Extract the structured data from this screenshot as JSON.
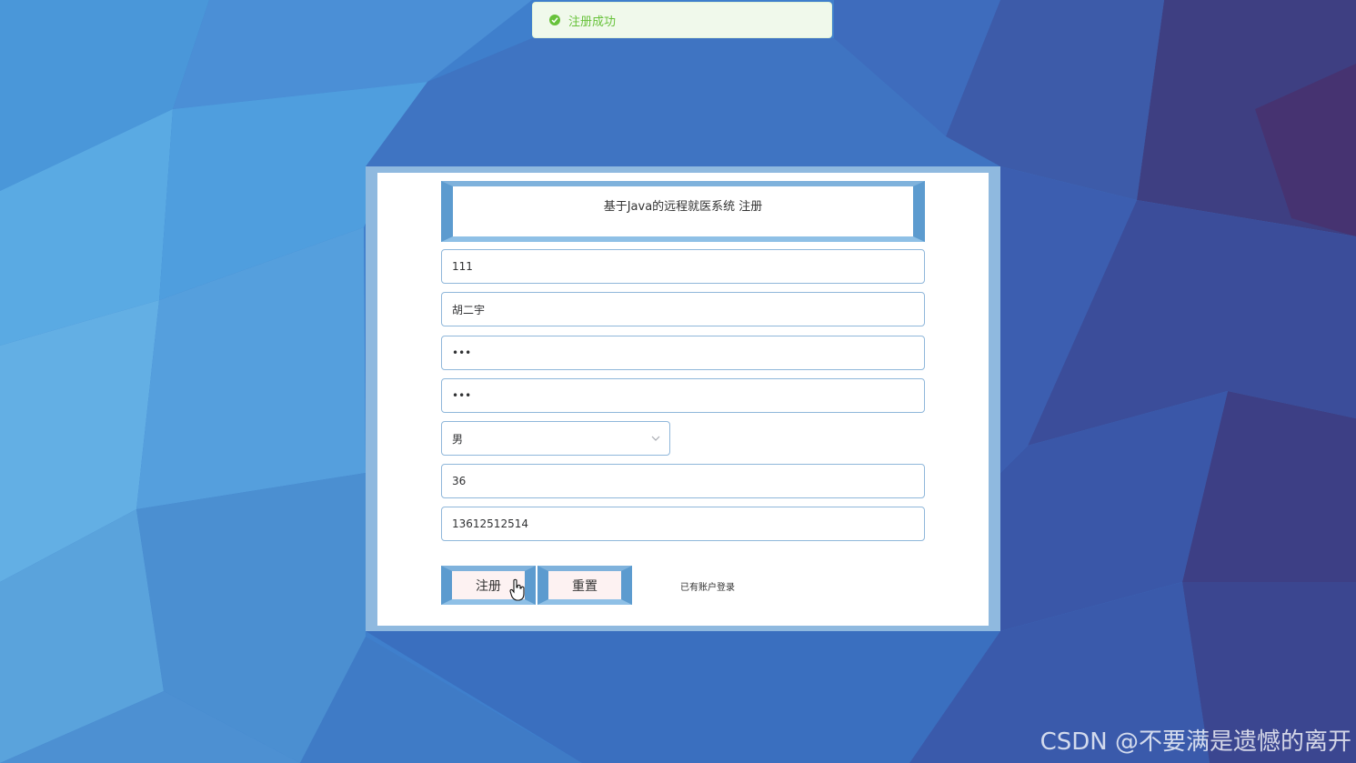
{
  "toast": {
    "icon": "check-circle-icon",
    "message": "注册成功",
    "color": "#67c23a"
  },
  "form": {
    "title": "基于Java的远程就医系统 注册",
    "fields": {
      "account": "111",
      "name": "胡二宇",
      "password": "•••",
      "confirm_password": "•••",
      "gender": "男",
      "age": "36",
      "phone": "13612512514"
    },
    "buttons": {
      "register": "注册",
      "reset": "重置"
    },
    "login_link": "已有账户登录"
  },
  "watermark": "CSDN @不要满是遗憾的离开",
  "colors": {
    "frame": "#8fb9df",
    "bevel": "#5c9bcf",
    "button_face": "#fdf2f2"
  }
}
